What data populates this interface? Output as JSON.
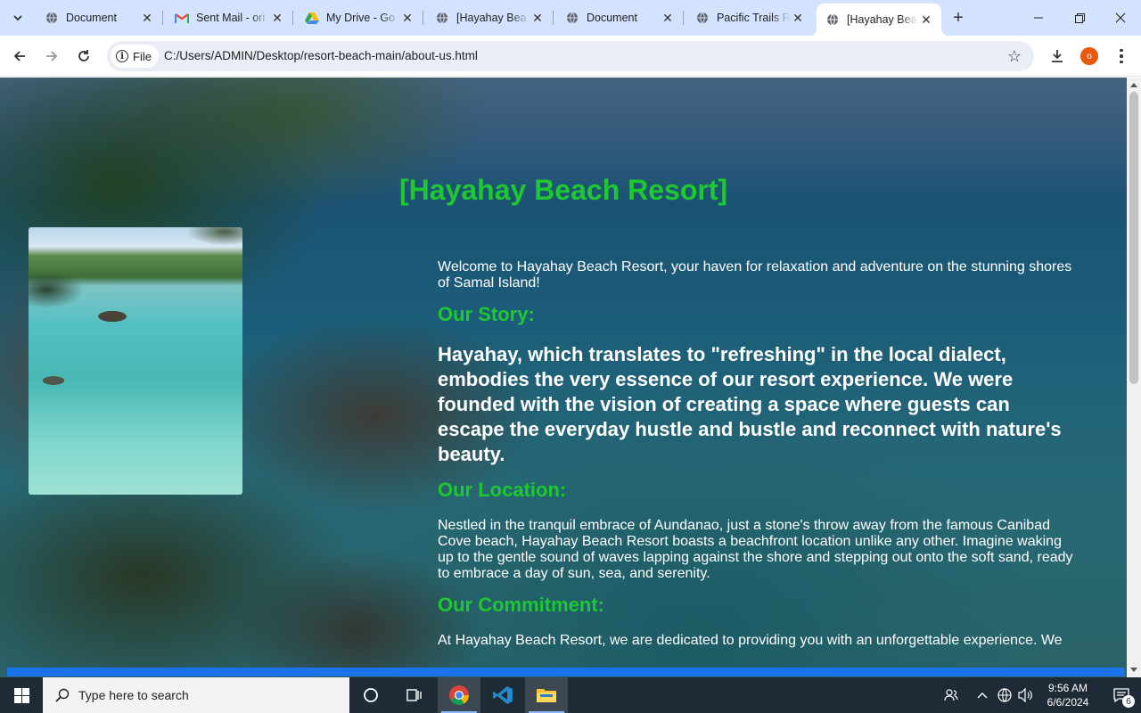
{
  "browser": {
    "tabs": [
      {
        "title": "Document",
        "icon": "globe-icon"
      },
      {
        "title": "Sent Mail - ori",
        "icon": "gmail-icon"
      },
      {
        "title": "My Drive - Go",
        "icon": "google-drive-icon"
      },
      {
        "title": "[Hayahay Bea",
        "icon": "globe-icon"
      },
      {
        "title": "Document",
        "icon": "globe-icon"
      },
      {
        "title": "Pacific Trails R",
        "icon": "globe-icon"
      },
      {
        "title": "[Hayahay Bea",
        "icon": "globe-icon",
        "active": true
      }
    ],
    "address_chip": "File",
    "url": "C:/Users/ADMIN/Desktop/resort-beach-main/about-us.html",
    "profile_initial": "o"
  },
  "page": {
    "site_title": "[Hayahay Beach Resort]",
    "welcome": "Welcome to Hayahay Beach Resort, your haven for relaxation and adventure on the stunning shores of Samal Island!",
    "story_heading": "Our Story:",
    "story_text": "Hayahay, which translates to \"refreshing\" in the local dialect, embodies the very essence of our resort experience. We were founded with the vision of creating a space where guests can escape the everyday hustle and bustle and reconnect with nature's beauty.",
    "location_heading": "Our Location:",
    "location_text": "Nestled in the tranquil embrace of Aundanao, just a stone's throw away from the famous Canibad Cove beach, Hayahay Beach Resort boasts a beachfront location unlike any other. Imagine waking up to the gentle sound of waves lapping against the shore and stepping out onto the soft sand, ready to embrace a day of sun, sea, and serenity.",
    "commitment_heading": "Our Commitment:",
    "commitment_text_partial": "At Hayahay Beach Resort, we are dedicated to providing you with an unforgettable experience. We"
  },
  "taskbar": {
    "search_placeholder": "Type here to search",
    "time": "9:56 AM",
    "date": "6/6/2024",
    "notification_count": "6"
  },
  "colors": {
    "accent_green": "#1ec830",
    "progress_blue": "#1a73e8",
    "tabstrip": "#d3e3fd",
    "taskbar": "#1e2a36"
  }
}
